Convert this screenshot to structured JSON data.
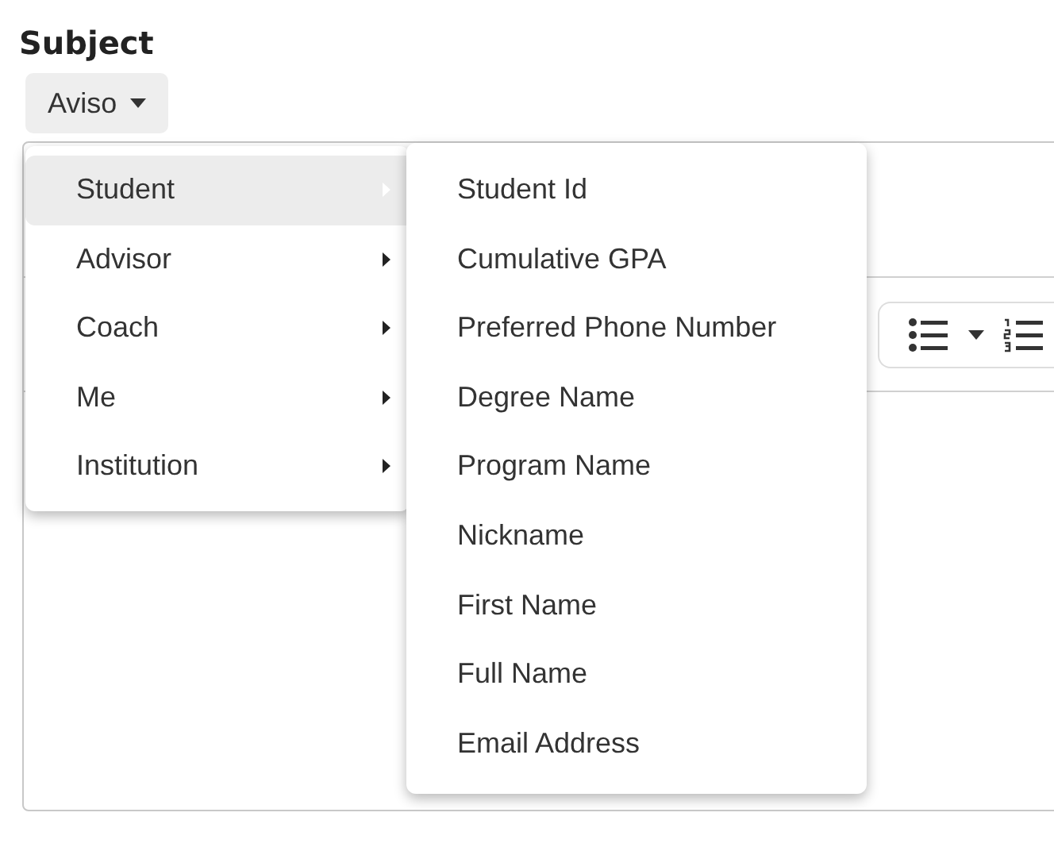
{
  "subject_label": "Subject",
  "template_button": {
    "label": "Aviso"
  },
  "menu": [
    {
      "label": "Student",
      "selected": true
    },
    {
      "label": "Advisor",
      "selected": false
    },
    {
      "label": "Coach",
      "selected": false
    },
    {
      "label": "Me",
      "selected": false
    },
    {
      "label": "Institution",
      "selected": false
    }
  ],
  "submenu": [
    "Student Id",
    "Cumulative GPA",
    "Preferred Phone Number",
    "Degree Name",
    "Program Name",
    "Nickname",
    "First Name",
    "Full Name",
    "Email Address"
  ]
}
